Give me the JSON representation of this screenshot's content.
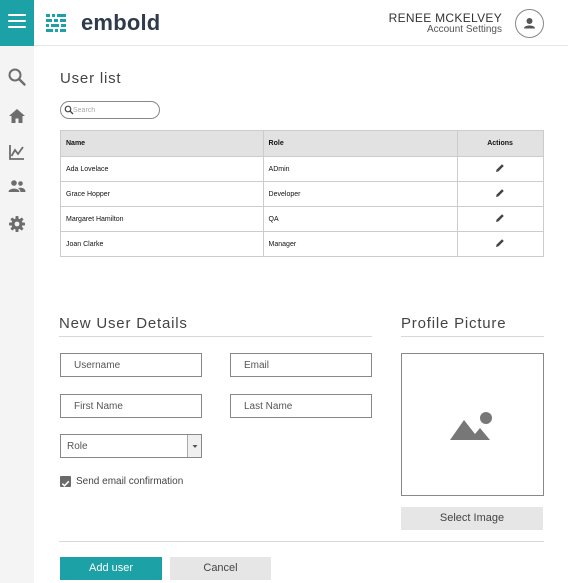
{
  "brand": {
    "name": "embold",
    "accent": "#1ba1a6"
  },
  "sidebar": {
    "items": [
      {
        "icon": "search-icon"
      },
      {
        "icon": "home-icon"
      },
      {
        "icon": "chart-icon"
      },
      {
        "icon": "users-icon"
      },
      {
        "icon": "gear-icon"
      }
    ]
  },
  "header": {
    "user_name": "RENEE MCKELVEY",
    "account_settings": "Account Settings"
  },
  "user_list": {
    "title": "User list",
    "search_placeholder": "Search",
    "columns": [
      "Name",
      "Role",
      "Actions"
    ],
    "rows": [
      {
        "name": "Ada Lovelace",
        "role": "ADmin"
      },
      {
        "name": "Grace Hopper",
        "role": "Developer"
      },
      {
        "name": "Margaret Hamilton",
        "role": "QA"
      },
      {
        "name": "Joan Clarke",
        "role": "Manager"
      }
    ]
  },
  "new_user": {
    "title": "New User Details",
    "username_placeholder": "Username",
    "email_placeholder": "Email",
    "first_name_placeholder": "First Name",
    "last_name_placeholder": "Last Name",
    "role_placeholder": "Role",
    "send_email_label": "Send email confirmation",
    "send_email_checked": true
  },
  "profile_picture": {
    "title": "Profile Picture",
    "select_image_label": "Select Image"
  },
  "actions": {
    "add_user_label": "Add user",
    "cancel_label": "Cancel"
  }
}
